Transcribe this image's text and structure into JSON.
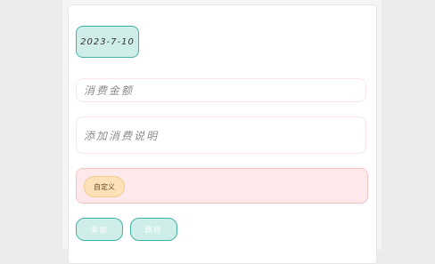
{
  "form": {
    "date_value": "2023-7-10",
    "amount_placeholder": "消费金额",
    "description_placeholder": "添加消费说明",
    "tag_label": "自定义"
  },
  "actions": {
    "add_label": "添加",
    "delete_label": "删除"
  },
  "colors": {
    "accent_teal": "#3fb3a5",
    "teal_fill": "#cfeee9",
    "pink_fill": "#fde9e9",
    "tag_fill": "#fde2b8"
  }
}
